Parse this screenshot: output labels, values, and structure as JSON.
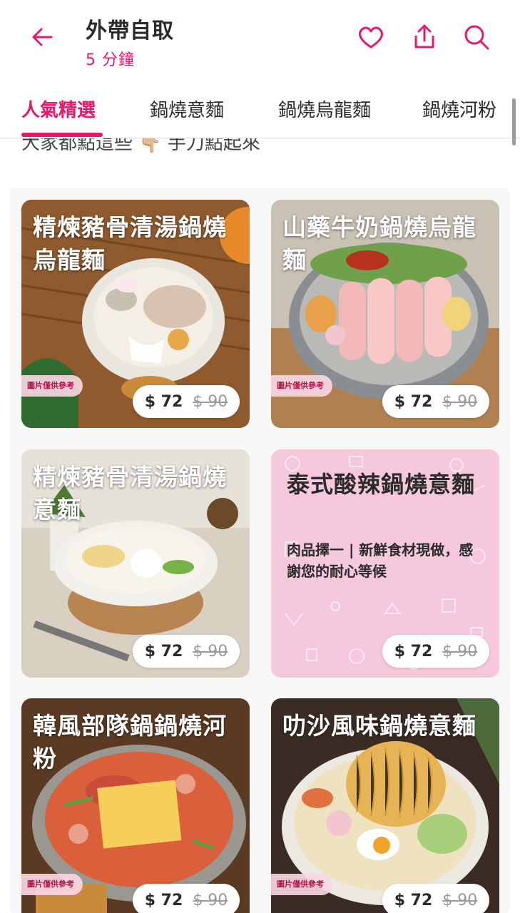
{
  "header": {
    "title": "外帶自取",
    "subtitle": "5 分鐘",
    "icons": [
      "back-arrow-icon",
      "heart-icon",
      "share-icon",
      "search-icon"
    ],
    "accent_color": "#e21b70"
  },
  "tabs": [
    {
      "label": "人氣精選",
      "active": true
    },
    {
      "label": "鍋燒意麵",
      "active": false
    },
    {
      "label": "鍋燒烏龍麵",
      "active": false
    },
    {
      "label": "鍋燒河粉",
      "active": false
    }
  ],
  "section": {
    "subtitle_visible": "大家都點這些 👇🏼 手刀點起來"
  },
  "items": [
    {
      "name": "精煉豬骨清湯鍋燒烏龍麵",
      "price": "$ 72",
      "original_price": "$ 90",
      "tag": "圖片僅供參考"
    },
    {
      "name": "山藥牛奶鍋燒烏龍麵",
      "price": "$ 72",
      "original_price": "$ 90",
      "tag": "圖片僅供參考"
    },
    {
      "name": "精煉豬骨清湯鍋燒意麵",
      "price": "$ 72",
      "original_price": "$ 90",
      "tag": ""
    },
    {
      "name": "泰式酸辣鍋燒意麵",
      "description": "肉品擇一 | 新鮮食材現做，感謝您的耐心等候",
      "price": "$ 72",
      "original_price": "$ 90"
    },
    {
      "name": "韓風部隊鍋鍋燒河粉",
      "price": "$ 72",
      "original_price": "$ 90",
      "tag": "圖片僅供參考"
    },
    {
      "name": "叻沙風味鍋燒意麵",
      "price": "$ 72",
      "original_price": "$ 90",
      "tag": "圖片僅供參考"
    }
  ]
}
